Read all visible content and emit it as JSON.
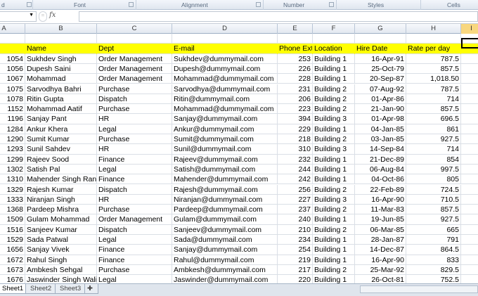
{
  "ribbon": {
    "groups": [
      "d",
      "Font",
      "Alignment",
      "Number",
      "Styles",
      "Cells"
    ]
  },
  "formula_bar": {
    "fx_label": "fx",
    "name_box": "",
    "formula": ""
  },
  "columns": [
    "A",
    "B",
    "C",
    "D",
    "E",
    "F",
    "G",
    "H",
    "I"
  ],
  "header_row": [
    "e ID",
    "Name",
    "Dept",
    "E-mail",
    "Phone Ext",
    "Location",
    "Hire Date",
    "Rate per day"
  ],
  "rows": [
    [
      "1054",
      "Sukhdev Singh",
      "Order Management",
      "Sukhdev@dummymail.com",
      "253",
      "Building 1",
      "16-Apr-91",
      "787.5"
    ],
    [
      "1056",
      "Dupesh Saini",
      "Order Management",
      "Dupesh@dummymail.com",
      "226",
      "Building 1",
      "25-Oct-79",
      "857.5"
    ],
    [
      "1067",
      "Mohammad",
      "Order Management",
      "Mohammad@dummymail.com",
      "228",
      "Building 1",
      "20-Sep-87",
      "1,018.50"
    ],
    [
      "1075",
      "Sarvodhya Bahri",
      "Purchase",
      "Sarvodhya@dummymail.com",
      "231",
      "Building 2",
      "07-Aug-92",
      "787.5"
    ],
    [
      "1078",
      "Ritin Gupta",
      "Dispatch",
      "Ritin@dummymail.com",
      "206",
      "Building 2",
      "01-Apr-86",
      "714"
    ],
    [
      "1152",
      "Mohammad Aatif",
      "Purchase",
      "Mohammad@dummymail.com",
      "223",
      "Building 2",
      "21-Jan-90",
      "857.5"
    ],
    [
      "1196",
      "Sanjay Pant",
      "HR",
      "Sanjay@dummymail.com",
      "394",
      "Building 3",
      "01-Apr-98",
      "696.5"
    ],
    [
      "1284",
      "Ankur Khera",
      "Legal",
      "Ankur@dummymail.com",
      "229",
      "Building 1",
      "04-Jan-85",
      "861"
    ],
    [
      "1290",
      "Sumit Kumar",
      "Purchase",
      "Sumit@dummymail.com",
      "218",
      "Building 2",
      "03-Jan-85",
      "927.5"
    ],
    [
      "1293",
      "Sunil Sahdev",
      "HR",
      "Sunil@dummymail.com",
      "310",
      "Building 3",
      "14-Sep-84",
      "714"
    ],
    [
      "1299",
      "Rajeev Sood",
      "Finance",
      "Rajeev@dummymail.com",
      "232",
      "Building 1",
      "21-Dec-89",
      "854"
    ],
    [
      "1302",
      "Satish Pal",
      "Legal",
      "Satish@dummymail.com",
      "244",
      "Building 1",
      "06-Aug-84",
      "997.5"
    ],
    [
      "1310",
      "Mahender Singh Rana",
      "Finance",
      "Mahender@dummymail.com",
      "242",
      "Building 1",
      "04-Oct-86",
      "805"
    ],
    [
      "1329",
      "Rajesh Kumar",
      "Dispatch",
      "Rajesh@dummymail.com",
      "256",
      "Building 2",
      "22-Feb-89",
      "724.5"
    ],
    [
      "1333",
      "Niranjan Singh",
      "HR",
      "Niranjan@dummymail.com",
      "227",
      "Building 3",
      "16-Apr-90",
      "710.5"
    ],
    [
      "1368",
      "Pardeep Mishra",
      "Purchase",
      "Pardeep@dummymail.com",
      "237",
      "Building 2",
      "11-Mar-83",
      "857.5"
    ],
    [
      "1509",
      "Gulam Mohammad",
      "Order Management",
      "Gulam@dummymail.com",
      "240",
      "Building 1",
      "19-Jun-85",
      "927.5"
    ],
    [
      "1516",
      "Sanjeev Kumar",
      "Dispatch",
      "Sanjeev@dummymail.com",
      "210",
      "Building 2",
      "06-Mar-85",
      "665"
    ],
    [
      "1529",
      "Sada Patwal",
      "Legal",
      "Sada@dummymail.com",
      "234",
      "Building 1",
      "28-Jan-87",
      "791"
    ],
    [
      "1656",
      "Sanjay Vivek",
      "Finance",
      "Sanjay@dummymail.com",
      "254",
      "Building 1",
      "14-Dec-87",
      "864.5"
    ],
    [
      "1672",
      "Rahul Singh",
      "Finance",
      "Rahul@dummymail.com",
      "219",
      "Building 1",
      "16-Apr-90",
      "833"
    ],
    [
      "1673",
      "Ambkesh Sehgal",
      "Purchase",
      "Ambkesh@dummymail.com",
      "217",
      "Building 2",
      "25-Mar-92",
      "829.5"
    ],
    [
      "1676",
      "Jaswinder Singh Walia",
      "Legal",
      "Jaswinder@dummymail.com",
      "220",
      "Building 1",
      "26-Oct-81",
      "752.5"
    ]
  ],
  "sheets": [
    "Sheet1",
    "Sheet2",
    "Sheet3"
  ],
  "colors": {
    "header_fill": "#ffff00",
    "selected_col": "#f8d77f"
  }
}
